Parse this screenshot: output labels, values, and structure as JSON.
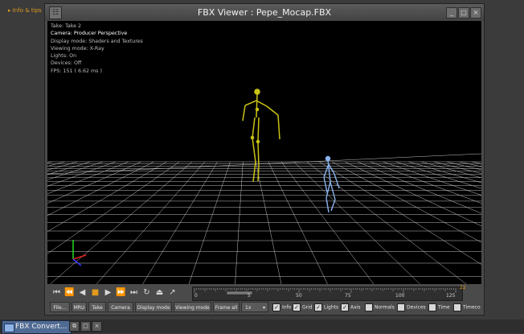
{
  "desktop": {
    "corner_label": "▸ Info & tips"
  },
  "window": {
    "title": "FBX Viewer : Pepe_Mocap.FBX",
    "minimize_glyph": "_",
    "maximize_glyph": "□",
    "close_glyph": "×"
  },
  "viewport": {
    "info_lines": [
      "Take: Take 2",
      "Camera: Producer Perspective",
      "Display mode: Shaders and Textures",
      "Viewing mode: X-Ray",
      "Lights: On",
      "Devices: Off",
      "FPS: 151 ( 6.62 ms )"
    ]
  },
  "transport": {
    "buttons": [
      "⏮",
      "⏪",
      "◀",
      "■",
      "▶",
      "⏩",
      "⏭",
      "↻",
      "⏏",
      "↗"
    ],
    "timeline_ticks": [
      "0",
      "5",
      "50",
      "75",
      "100",
      "125"
    ],
    "timeline_end": "22"
  },
  "bottom_bar": {
    "buttons": [
      "File...",
      "MRU",
      "Take",
      "Camera",
      "Display mode",
      "Viewing mode",
      "Frame all",
      "1x"
    ],
    "zoom_arrow": "▾",
    "toggles": [
      {
        "label": "Info",
        "checked": true
      },
      {
        "label": "Grid",
        "checked": true
      },
      {
        "label": "Lights",
        "checked": true
      },
      {
        "label": "Axis",
        "checked": true
      },
      {
        "label": "Normals",
        "checked": false
      },
      {
        "label": "Devices",
        "checked": false
      },
      {
        "label": "Time",
        "checked": false
      },
      {
        "label": "Timeco",
        "checked": false
      }
    ]
  },
  "taskbar": {
    "task_label": "FBX Convert...",
    "restore_glyph": "⧉",
    "maximize_glyph": "□",
    "close_glyph": "×"
  },
  "colors": {
    "skeleton_yellow": "#c9c214",
    "skeleton_blue": "#8ab4ef",
    "grid_line": "#ffffff",
    "accent_orange": "#e09a1e"
  }
}
